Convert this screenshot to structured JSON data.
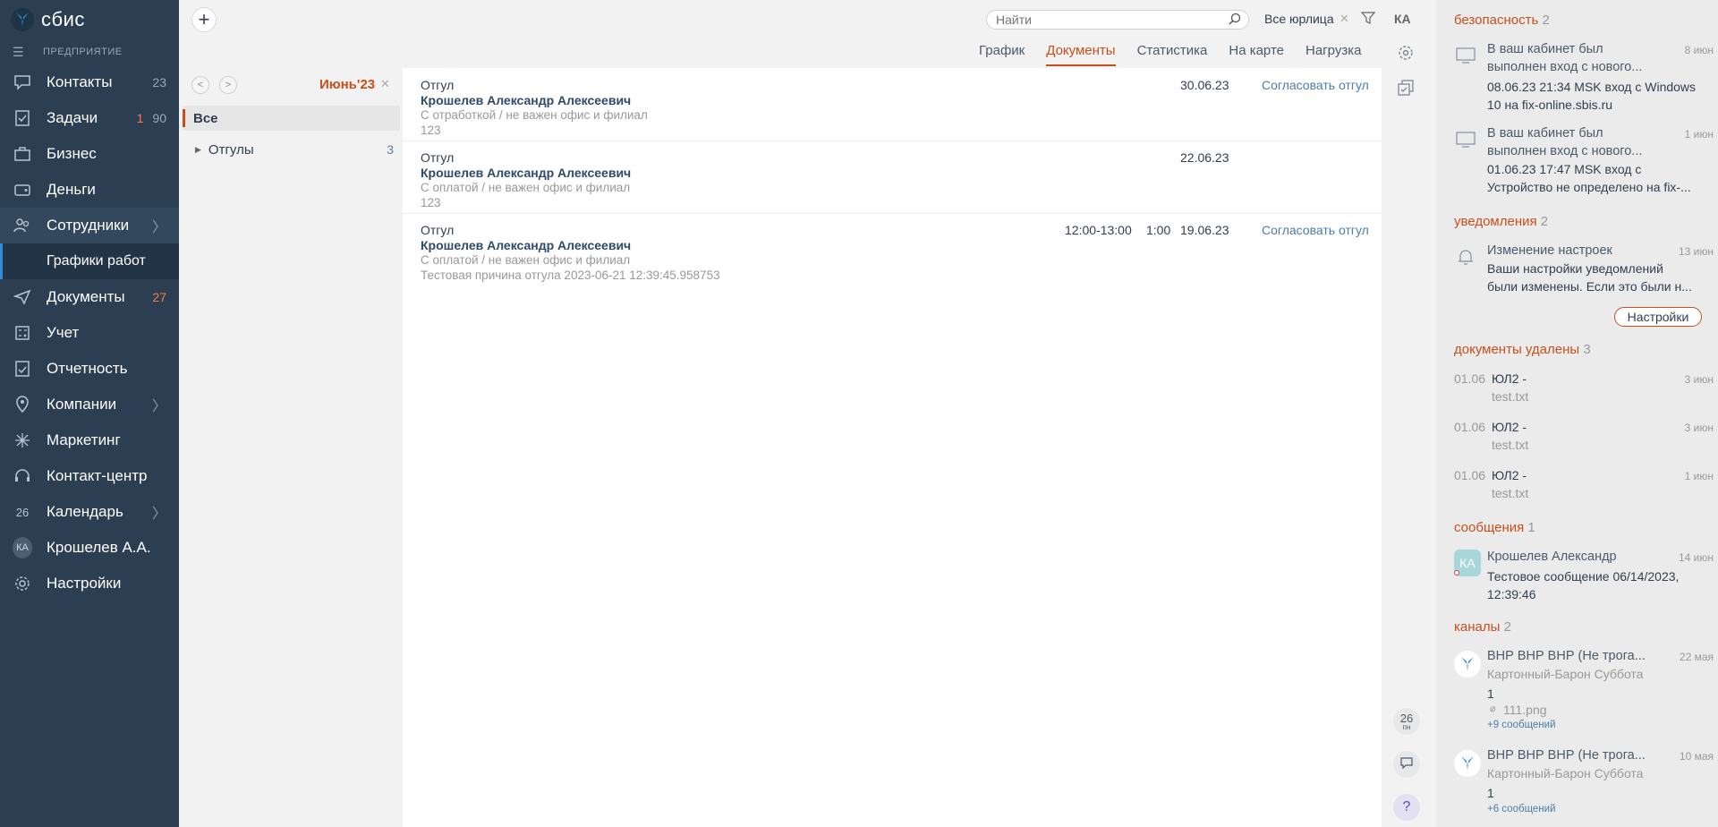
{
  "nav": {
    "brand": "сбис",
    "company": "ПРЕДПРИЯТИЕ",
    "items": [
      {
        "label": "Контакты",
        "count": "23",
        "icon": "chat-icon"
      },
      {
        "label": "Задачи",
        "count_red": "1",
        "count": "90",
        "icon": "tasks-icon"
      },
      {
        "label": "Бизнес",
        "icon": "briefcase-icon"
      },
      {
        "label": "Деньги",
        "icon": "money-icon"
      },
      {
        "label": "Сотрудники",
        "icon": "people-icon"
      },
      {
        "label": "Графики работ"
      },
      {
        "label": "Документы",
        "count": "27",
        "icon": "paper-plane-icon"
      },
      {
        "label": "Учет",
        "icon": "calculator-icon"
      },
      {
        "label": "Отчетность",
        "icon": "report-icon"
      },
      {
        "label": "Компании",
        "icon": "location-icon"
      },
      {
        "label": "Маркетинг",
        "icon": "sparkle-icon"
      },
      {
        "label": "Контакт-центр",
        "icon": "headset-icon"
      },
      {
        "label": "Календарь",
        "day": "26",
        "icon": "calendar-icon"
      },
      {
        "label": "Крошелев А.А.",
        "initials": "КА"
      },
      {
        "label": "Настройки",
        "icon": "gear-icon"
      }
    ]
  },
  "topbar": {
    "search_placeholder": "Найти",
    "legal": "Все юрлица",
    "user_initials": "КА"
  },
  "tabs": [
    "График",
    "Документы",
    "Статистика",
    "На карте",
    "Нагрузка"
  ],
  "folders": {
    "period": "Июнь'23",
    "all": "Все",
    "items": [
      {
        "label": "Отгулы",
        "count": "3"
      }
    ]
  },
  "docs": [
    {
      "type": "Отгул",
      "name": "Крошелев Александр Алексеевич",
      "sub": "С отработкой / не важен офис и филиал",
      "note": "123",
      "date": "30.06.23",
      "action": "Согласовать отгул"
    },
    {
      "type": "Отгул",
      "name": "Крошелев Александр Алексеевич",
      "sub": "С оплатой / не важен офис и филиал",
      "note": "123",
      "date": "22.06.23"
    },
    {
      "type": "Отгул",
      "name": "Крошелев Александр Алексеевич",
      "sub": "С оплатой / не важен офис и филиал",
      "note": "Тестовая причина отгула 2023-06-21 12:39:45.958753",
      "time": "12:00-13:00",
      "duration": "1:00",
      "date": "19.06.23",
      "action": "Согласовать отгул"
    }
  ],
  "mini": {
    "day": "26",
    "weekday": "пн",
    "help": "?"
  },
  "panel": {
    "security": {
      "title": "безопасность",
      "count": "2",
      "events": [
        {
          "title1": "В ваш кабинет был",
          "title2": "выполнен вход с нового...",
          "time": "8 июн",
          "body": "08.06.23 21:34 MSK вход с Windows 10 на fix-online.sbis.ru"
        },
        {
          "title1": "В ваш кабинет был",
          "title2": "выполнен вход с нового...",
          "time": "1 июн",
          "body1": "01.06.23 17:47 MSK вход с",
          "body2": "Устройство не определено на fix-..."
        }
      ]
    },
    "notifications": {
      "title": "уведомления",
      "count": "2",
      "event": {
        "title": "Изменение настроек",
        "time": "13 июн",
        "body1": "Ваши настройки уведомлений",
        "body2": "были изменены. Если это были н..."
      },
      "button": "Настройки"
    },
    "deleted": {
      "title": "документы удалены",
      "count": "3",
      "items": [
        {
          "date": "01.06",
          "name": "ЮЛ2 -",
          "file": "test.txt",
          "time": "3 июн"
        },
        {
          "date": "01.06",
          "name": "ЮЛ2 -",
          "file": "test.txt",
          "time": "3 июн"
        },
        {
          "date": "01.06",
          "name": "ЮЛ2 -",
          "file": "test.txt",
          "time": "1 июн"
        }
      ]
    },
    "messages": {
      "title": "сообщения",
      "count": "1",
      "event": {
        "initials": "КА",
        "title": "Крошелев Александр",
        "time": "14 июн",
        "body": "Тестовое сообщение 06/14/2023, 12:39:46"
      }
    },
    "channels": {
      "title": "каналы",
      "count": "2",
      "events": [
        {
          "title": "ВНР ВНР ВНР (Не трога...",
          "time": "22 мая",
          "author": "Картонный-Барон Суббота",
          "text": "1",
          "file": "111.png",
          "more": "+9 сообщений"
        },
        {
          "title": "ВНР ВНР ВНР (Не трога...",
          "time": "10 мая",
          "author": "Картонный-Барон Суббота",
          "text": "1",
          "more": "+6 сообщений"
        }
      ]
    }
  }
}
